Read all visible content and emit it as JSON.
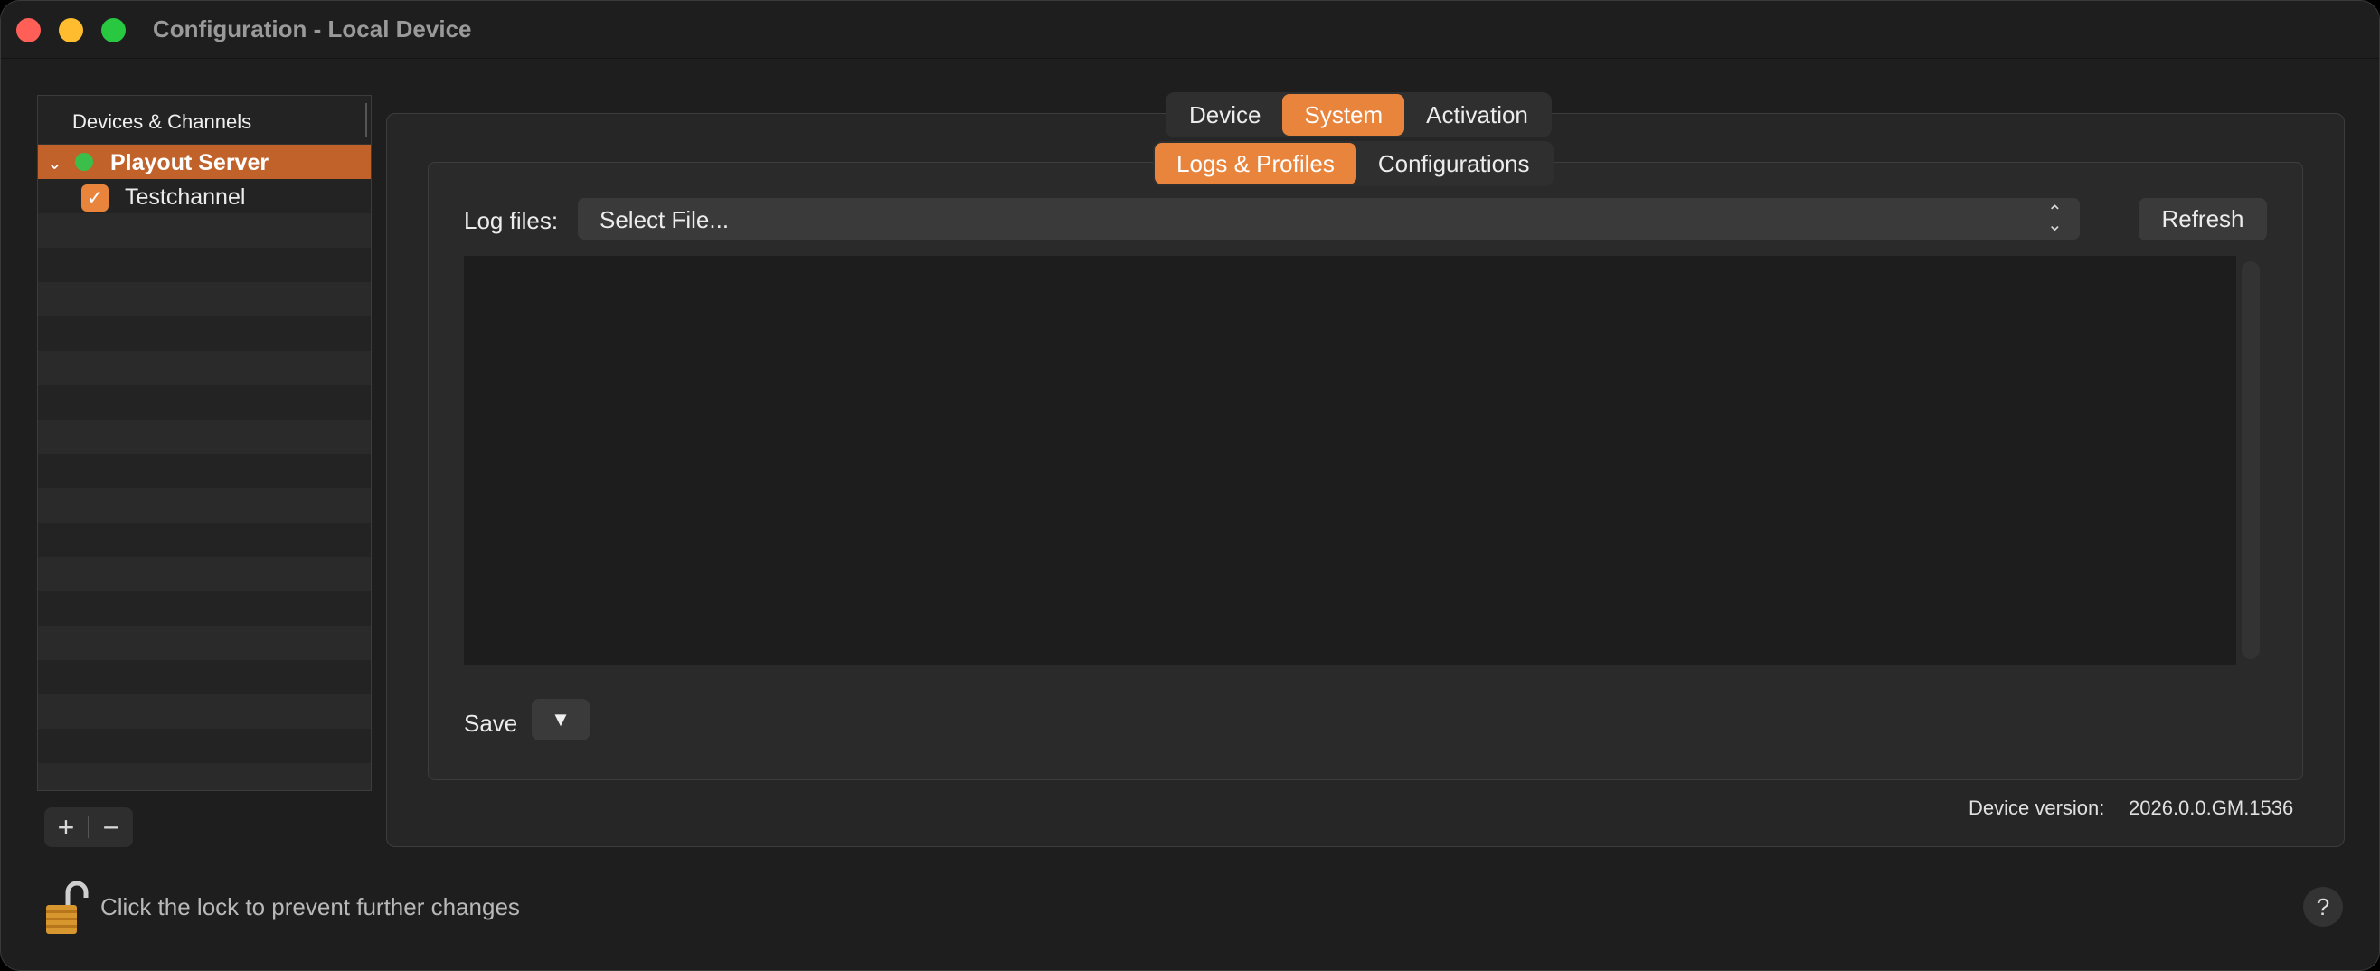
{
  "window": {
    "title": "Configuration - Local Device"
  },
  "sidebar": {
    "header": "Devices & Channels",
    "server": {
      "label": "Playout Server",
      "expanded": true,
      "status_color": "#3bbf4a"
    },
    "channel": {
      "label": "Testchannel",
      "checked": true
    },
    "add_label": "+",
    "remove_label": "−"
  },
  "tabs": {
    "top": [
      {
        "label": "Device",
        "active": false
      },
      {
        "label": "System",
        "active": true
      },
      {
        "label": "Activation",
        "active": false
      }
    ],
    "sub": [
      {
        "label": "Logs & Profiles",
        "active": true
      },
      {
        "label": "Configurations",
        "active": false
      }
    ]
  },
  "logs": {
    "label": "Log files:",
    "select_value": "Select File...",
    "refresh_label": "Refresh",
    "save_label": "Save",
    "save_menu_glyph": "▼"
  },
  "device_version": {
    "label": "Device version:",
    "value": "2026.0.0.GM.1536"
  },
  "footer": {
    "lock_text": "Click the lock to prevent further changes",
    "help_label": "?"
  },
  "colors": {
    "accent": "#e8843c",
    "selection": "#c0622a",
    "background": "#1e1e1e"
  }
}
